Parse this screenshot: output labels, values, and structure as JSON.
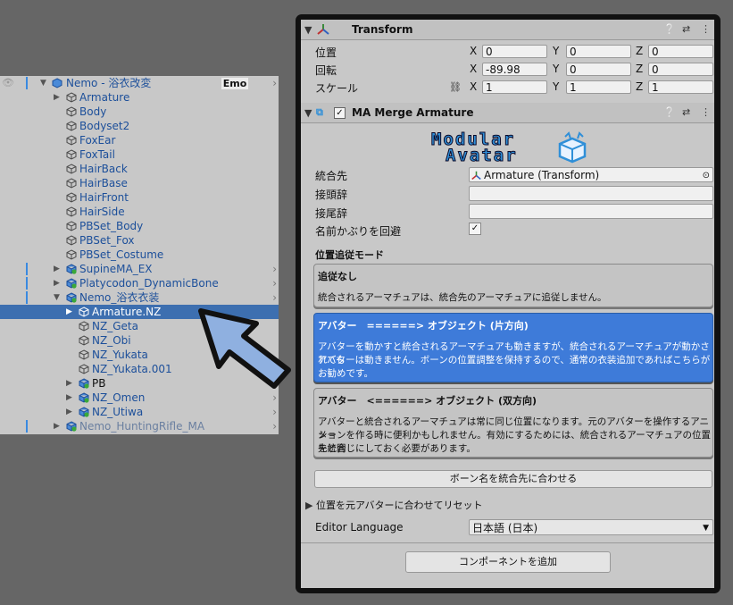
{
  "hierarchy": {
    "items": [
      {
        "label": "Nemo - 浴衣改変",
        "badge": "Emo"
      },
      {
        "label": "Armature"
      },
      {
        "label": "Body"
      },
      {
        "label": "Bodyset2"
      },
      {
        "label": "FoxEar"
      },
      {
        "label": "FoxTail"
      },
      {
        "label": "HairBack"
      },
      {
        "label": "HairBase"
      },
      {
        "label": "HairFront"
      },
      {
        "label": "HairSide"
      },
      {
        "label": "PBSet_Body"
      },
      {
        "label": "PBSet_Fox"
      },
      {
        "label": "PBSet_Costume"
      },
      {
        "label": "SupineMA_EX"
      },
      {
        "label": "Platycodon_DynamicBone"
      },
      {
        "label": "Nemo_浴衣衣装"
      },
      {
        "label": "Armature.NZ"
      },
      {
        "label": "NZ_Geta"
      },
      {
        "label": "NZ_Obi"
      },
      {
        "label": "NZ_Yukata"
      },
      {
        "label": "NZ_Yukata.001"
      },
      {
        "label": "PB"
      },
      {
        "label": "NZ_Omen"
      },
      {
        "label": "NZ_Utiwa"
      },
      {
        "label": "Nemo_HuntingRifle_MA"
      }
    ]
  },
  "transform": {
    "title": "Transform",
    "position_label": "位置",
    "rotation_label": "回転",
    "scale_label": "スケール",
    "axis_x": "X",
    "axis_y": "Y",
    "axis_z": "Z",
    "position": {
      "x": "0",
      "y": "0",
      "z": "0"
    },
    "rotation": {
      "x": "-89.98",
      "y": "0",
      "z": "0"
    },
    "scale": {
      "x": "1",
      "y": "1",
      "z": "1"
    }
  },
  "merge": {
    "title": "MA Merge Armature",
    "logo_line1": "Modular",
    "logo_line2": "Avatar",
    "target_label": "統合先",
    "target_value": "Armature (Transform)",
    "prefix_label": "接頭辞",
    "suffix_label": "接尾辞",
    "avoid_label": "名前かぶりを回避",
    "mode_heading": "位置追従モード",
    "modes": [
      {
        "title": "追従なし",
        "desc": "統合されるアーマチュアは、統合先のアーマチュアに追従しません。"
      },
      {
        "title": "アバター　======> オブジェクト (片方向)",
        "desc1": "アバターを動かすと統合されるアーマチュアも動きますが、統合されるアーマチュアが動かされても",
        "desc2": "アバターは動きません。ボーンの位置調整を保持するので、通常の衣装追加であればこちらが",
        "desc3": "お勧めです。"
      },
      {
        "title": "アバター　<======> オブジェクト (双方向)",
        "desc1": "アバターと統合されるアーマチュアは常に同じ位置になります。元のアバターを操作するアニメー",
        "desc2": "ションを作る時に便利かもしれません。有効にするためには、統合されるアーマチュアの位置を統合",
        "desc3": "先と同じにしておく必要があります。"
      }
    ],
    "match_button": "ボーン名を統合先に合わせる",
    "reset_label": "位置を元アバターに合わせてリセット",
    "lang_label": "Editor Language",
    "lang_value": "日本語 (日本)",
    "add_component": "コンポーネントを追加"
  },
  "colors": {
    "accent": "#3d6fb0",
    "logo": "#2f8fd8",
    "arrow_fill": "#8fb0e0"
  }
}
